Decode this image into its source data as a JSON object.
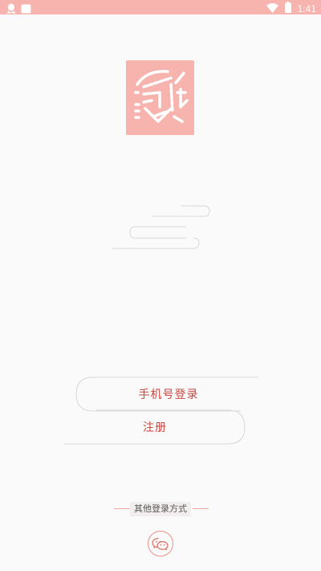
{
  "status_bar": {
    "time": "1:41",
    "icons": [
      "qq-icon",
      "notification-icon",
      "wifi-icon",
      "battery-icon"
    ],
    "color": "#f7b3ad"
  },
  "logo": {
    "icon": "app-logo",
    "color": "#f7b3ad"
  },
  "actions": {
    "phone_login": "手机号登录",
    "register": "注册"
  },
  "other_login": {
    "label": "其他登录方式",
    "icon": "wechat-icon"
  },
  "colors": {
    "accent": "#c9473f",
    "background": "#fafafa",
    "outline": "#dcdcdc"
  }
}
